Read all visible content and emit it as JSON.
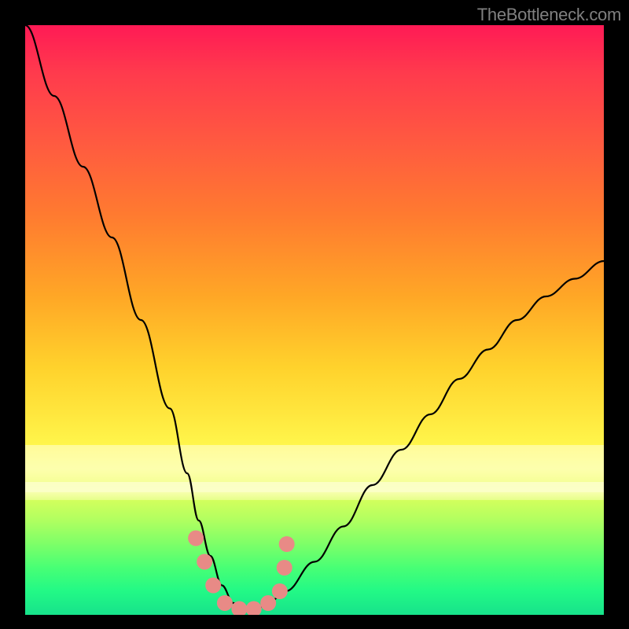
{
  "watermark": "TheBottleneck.com",
  "chart_data": {
    "type": "line",
    "title": "",
    "xlabel": "",
    "ylabel": "",
    "xlim": [
      0,
      100
    ],
    "ylim": [
      0,
      100
    ],
    "grid": false,
    "series": [
      {
        "name": "bottleneck-curve",
        "x": [
          0,
          5,
          10,
          15,
          20,
          25,
          28,
          30,
          32,
          34,
          36,
          38,
          40,
          42,
          45,
          50,
          55,
          60,
          65,
          70,
          75,
          80,
          85,
          90,
          95,
          100
        ],
        "values": [
          100,
          88,
          76,
          64,
          50,
          35,
          24,
          16,
          10,
          5,
          2,
          1,
          1,
          2,
          4,
          9,
          15,
          22,
          28,
          34,
          40,
          45,
          50,
          54,
          57,
          60
        ]
      }
    ],
    "markers": {
      "name": "salmon-beads",
      "color": "#e88a86",
      "radius": 10,
      "points": [
        {
          "x": 29.5,
          "y": 13
        },
        {
          "x": 31.0,
          "y": 9
        },
        {
          "x": 32.5,
          "y": 5
        },
        {
          "x": 34.5,
          "y": 2
        },
        {
          "x": 37.0,
          "y": 1
        },
        {
          "x": 39.5,
          "y": 1
        },
        {
          "x": 42.0,
          "y": 2
        },
        {
          "x": 44.0,
          "y": 4
        },
        {
          "x": 44.8,
          "y": 8
        },
        {
          "x": 45.2,
          "y": 12
        }
      ]
    },
    "background_gradient": {
      "top": "#ff1a55",
      "mid": "#fff84d",
      "bottom": "#17e28b"
    }
  }
}
